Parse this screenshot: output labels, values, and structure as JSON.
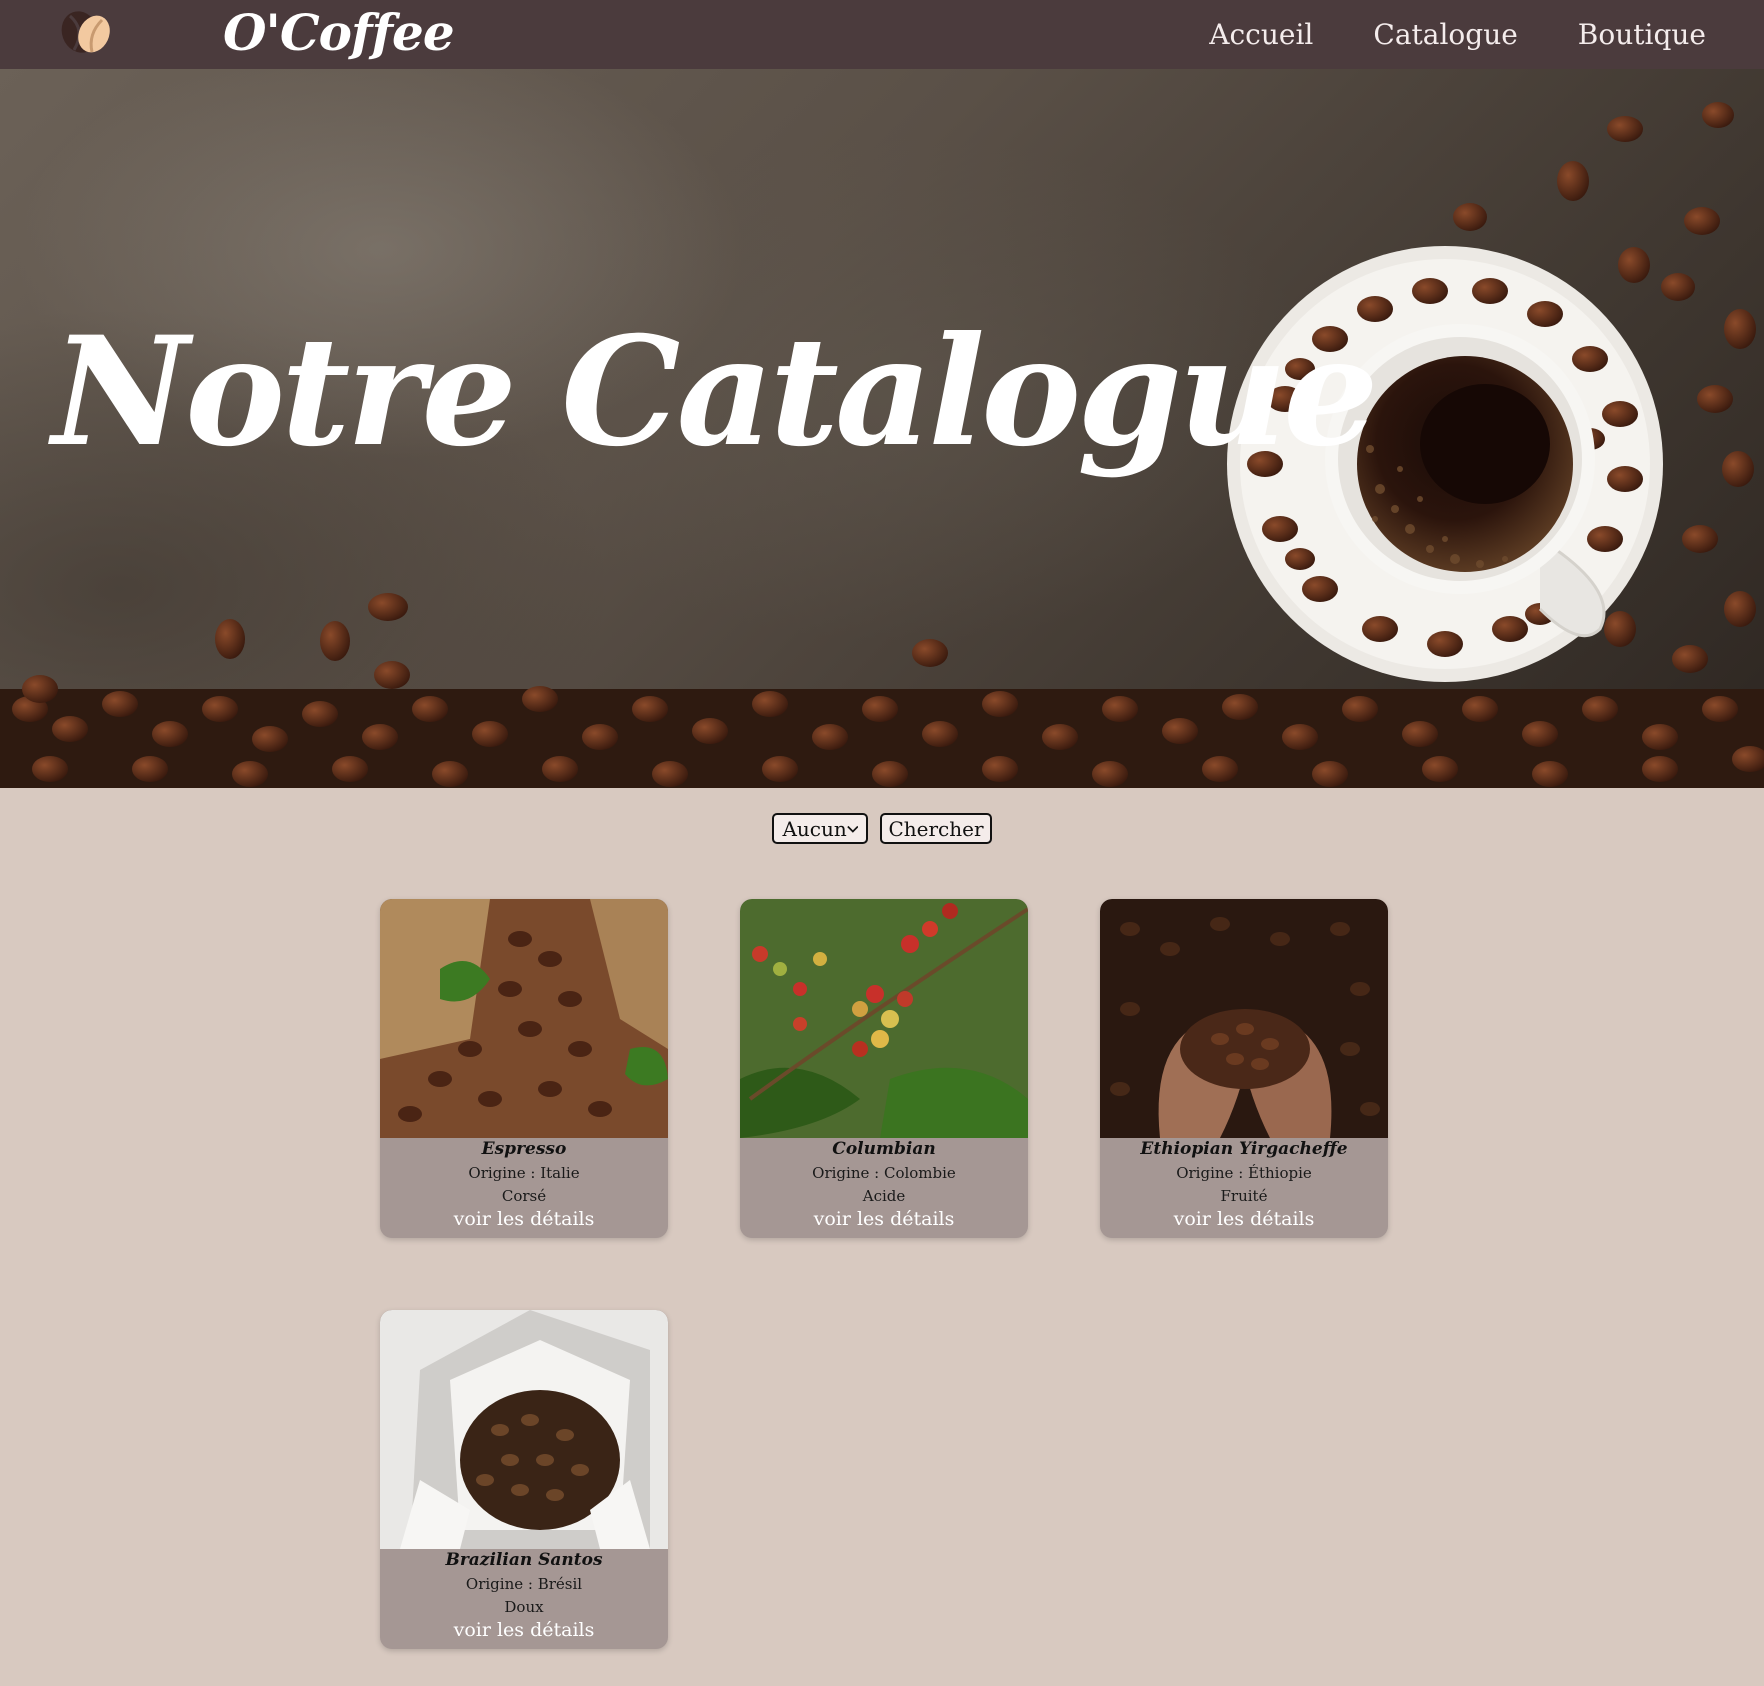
{
  "header": {
    "brand": "O'Coffee",
    "nav": [
      {
        "label": "Accueil"
      },
      {
        "label": "Catalogue"
      },
      {
        "label": "Boutique"
      }
    ]
  },
  "hero": {
    "title": "Notre Catalogue"
  },
  "filters": {
    "select_value": "Aucun",
    "search_label": "Chercher"
  },
  "products": [
    {
      "name": "Espresso",
      "origin": "Origine : Italie",
      "taste": "Corsé",
      "link": "voir les détails"
    },
    {
      "name": "Columbian",
      "origin": "Origine : Colombie",
      "taste": "Acide",
      "link": "voir les détails"
    },
    {
      "name": "Ethiopian Yirgacheffe",
      "origin": "Origine : Éthiopie",
      "taste": "Fruité",
      "link": "voir les détails"
    },
    {
      "name": "Brazilian Santos",
      "origin": "Origine : Brésil",
      "taste": "Doux",
      "link": "voir les détails"
    }
  ],
  "colors": {
    "header_bg": "#4b3b3d",
    "page_bg": "#d8c9c0",
    "card_bg": "#a59794"
  }
}
